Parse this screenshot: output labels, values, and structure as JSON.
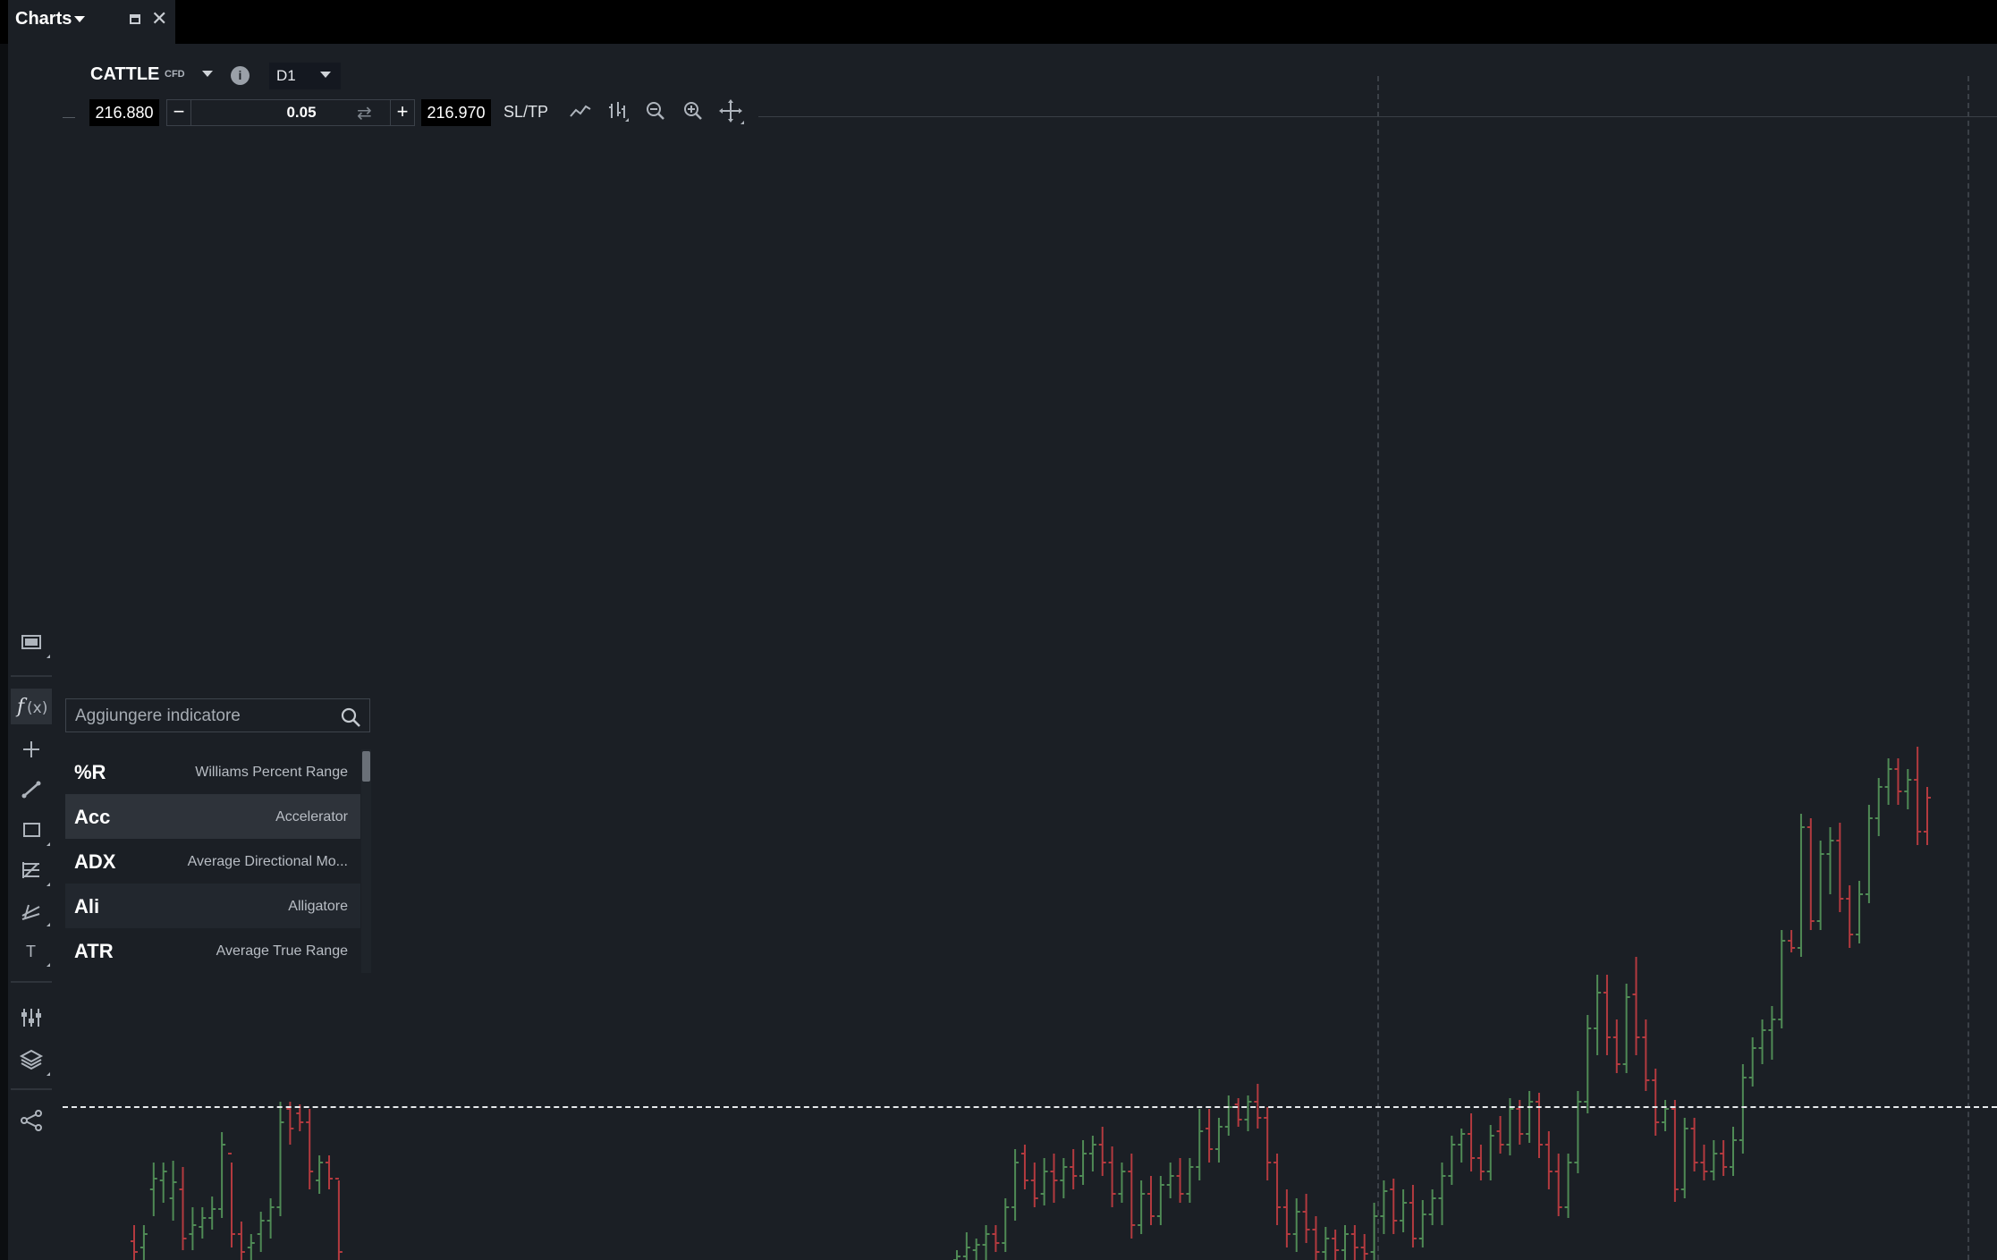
{
  "window": {
    "tab_title": "Charts"
  },
  "instrument": {
    "symbol": "CATTLE",
    "type": "CFD",
    "timeframe": "D1"
  },
  "order": {
    "sell_price": "216.880",
    "lot_size": "0.05",
    "buy_price": "216.970",
    "sltp_label": "SL/TP"
  },
  "toolbar_icons": [
    "line-chart-icon",
    "bar-chart-icon",
    "zoom-out-icon",
    "zoom-in-icon",
    "crosshair-move-icon"
  ],
  "left_tools": [
    "screen-icon",
    "fx-icon",
    "crosshair-icon",
    "line-draw-icon",
    "rectangle-icon",
    "fibonacci-icon",
    "channel-icon",
    "text-icon",
    "indicators-settings-icon",
    "layers-icon",
    "share-icon"
  ],
  "indicator_search": {
    "placeholder": "Aggiungere indicatore",
    "items": [
      {
        "code": "%R",
        "name": "Williams Percent Range"
      },
      {
        "code": "Acc",
        "name": "Accelerator"
      },
      {
        "code": "ADX",
        "name": "Average Directional Mo..."
      },
      {
        "code": "Ali",
        "name": "Alligatore"
      },
      {
        "code": "ATR",
        "name": "Average True Range"
      }
    ]
  },
  "colors": {
    "background": "#1b1f25",
    "bull": "#4f8a55",
    "bear": "#b33a3f"
  },
  "chart_data": {
    "type": "ohlc",
    "series_colors": {
      "up": "#4f8a55",
      "down": "#b33a3f"
    },
    "bars": [
      {
        "c": "r",
        "o": 1388,
        "h": 1370,
        "l": 1409,
        "cl": 1400
      },
      {
        "c": "g",
        "o": 1395,
        "h": 1370,
        "l": 1409,
        "cl": 1380
      },
      {
        "c": "g",
        "o": 1330,
        "h": 1300,
        "l": 1360,
        "cl": 1318
      },
      {
        "c": "g",
        "o": 1320,
        "h": 1300,
        "l": 1345,
        "cl": 1310
      },
      {
        "c": "g",
        "o": 1340,
        "h": 1298,
        "l": 1365,
        "cl": 1322
      },
      {
        "c": "r",
        "o": 1330,
        "h": 1305,
        "l": 1398,
        "cl": 1385
      },
      {
        "c": "g",
        "o": 1380,
        "h": 1350,
        "l": 1398,
        "cl": 1370
      },
      {
        "c": "g",
        "o": 1372,
        "h": 1350,
        "l": 1385,
        "cl": 1362
      },
      {
        "c": "g",
        "o": 1362,
        "h": 1338,
        "l": 1375,
        "cl": 1352
      },
      {
        "c": "g",
        "o": 1352,
        "h": 1266,
        "l": 1362,
        "cl": 1280
      },
      {
        "c": "r",
        "o": 1290,
        "h": 1300,
        "l": 1395,
        "cl": 1380
      },
      {
        "c": "r",
        "o": 1380,
        "h": 1366,
        "l": 1409,
        "cl": 1400
      },
      {
        "c": "g",
        "o": 1395,
        "h": 1380,
        "l": 1409,
        "cl": 1390
      },
      {
        "c": "g",
        "o": 1380,
        "h": 1355,
        "l": 1400,
        "cl": 1365
      },
      {
        "c": "g",
        "o": 1365,
        "h": 1340,
        "l": 1385,
        "cl": 1350
      },
      {
        "c": "g",
        "o": 1350,
        "h": 1232,
        "l": 1360,
        "cl": 1255
      },
      {
        "c": "r",
        "o": 1240,
        "h": 1232,
        "l": 1280,
        "cl": 1262
      },
      {
        "c": "r",
        "o": 1245,
        "h": 1235,
        "l": 1265,
        "cl": 1255
      },
      {
        "c": "r",
        "o": 1255,
        "h": 1240,
        "l": 1330,
        "cl": 1310
      },
      {
        "c": "g",
        "o": 1320,
        "h": 1292,
        "l": 1335,
        "cl": 1300
      },
      {
        "c": "r",
        "o": 1300,
        "h": 1292,
        "l": 1330,
        "cl": 1318
      },
      {
        "c": "r",
        "o": 1318,
        "h": 1320,
        "l": 1409,
        "cl": 1400
      }
    ],
    "bars2": [
      {
        "c": "g",
        "o": 1409,
        "h": 1398,
        "l": 1409,
        "cl": 1405
      },
      {
        "c": "g",
        "o": 1405,
        "h": 1378,
        "l": 1409,
        "cl": 1395
      },
      {
        "c": "g",
        "o": 1398,
        "h": 1385,
        "l": 1409,
        "cl": 1392
      },
      {
        "c": "g",
        "o": 1392,
        "h": 1370,
        "l": 1409,
        "cl": 1380
      },
      {
        "c": "r",
        "o": 1380,
        "h": 1370,
        "l": 1400,
        "cl": 1390
      },
      {
        "c": "g",
        "o": 1390,
        "h": 1340,
        "l": 1400,
        "cl": 1350
      },
      {
        "c": "g",
        "o": 1350,
        "h": 1285,
        "l": 1365,
        "cl": 1300
      },
      {
        "c": "r",
        "o": 1290,
        "h": 1280,
        "l": 1330,
        "cl": 1320
      },
      {
        "c": "r",
        "o": 1320,
        "h": 1300,
        "l": 1350,
        "cl": 1340
      },
      {
        "c": "g",
        "o": 1335,
        "h": 1295,
        "l": 1348,
        "cl": 1310
      },
      {
        "c": "r",
        "o": 1310,
        "h": 1290,
        "l": 1345,
        "cl": 1320
      },
      {
        "c": "g",
        "o": 1320,
        "h": 1295,
        "l": 1340,
        "cl": 1305
      },
      {
        "c": "r",
        "o": 1305,
        "h": 1285,
        "l": 1330,
        "cl": 1315
      },
      {
        "c": "g",
        "o": 1315,
        "h": 1275,
        "l": 1325,
        "cl": 1290
      },
      {
        "c": "g",
        "o": 1290,
        "h": 1270,
        "l": 1310,
        "cl": 1280
      },
      {
        "c": "r",
        "o": 1280,
        "h": 1260,
        "l": 1315,
        "cl": 1300
      },
      {
        "c": "r",
        "o": 1300,
        "h": 1282,
        "l": 1350,
        "cl": 1335
      },
      {
        "c": "g",
        "o": 1335,
        "h": 1300,
        "l": 1345,
        "cl": 1310
      },
      {
        "c": "r",
        "o": 1310,
        "h": 1290,
        "l": 1385,
        "cl": 1370
      },
      {
        "c": "g",
        "o": 1370,
        "h": 1320,
        "l": 1380,
        "cl": 1335
      },
      {
        "c": "r",
        "o": 1335,
        "h": 1315,
        "l": 1370,
        "cl": 1360
      },
      {
        "c": "g",
        "o": 1360,
        "h": 1315,
        "l": 1370,
        "cl": 1325
      },
      {
        "c": "g",
        "o": 1325,
        "h": 1300,
        "l": 1340,
        "cl": 1315
      },
      {
        "c": "r",
        "o": 1315,
        "h": 1295,
        "l": 1345,
        "cl": 1335
      },
      {
        "c": "g",
        "o": 1335,
        "h": 1295,
        "l": 1345,
        "cl": 1305
      },
      {
        "c": "g",
        "o": 1305,
        "h": 1240,
        "l": 1320,
        "cl": 1265
      },
      {
        "c": "r",
        "o": 1262,
        "h": 1240,
        "l": 1300,
        "cl": 1285
      },
      {
        "c": "g",
        "o": 1285,
        "h": 1250,
        "l": 1300,
        "cl": 1260
      },
      {
        "c": "g",
        "o": 1260,
        "h": 1225,
        "l": 1270,
        "cl": 1238
      },
      {
        "c": "r",
        "o": 1235,
        "h": 1228,
        "l": 1260,
        "cl": 1252
      },
      {
        "c": "g",
        "o": 1252,
        "h": 1225,
        "l": 1265,
        "cl": 1232
      },
      {
        "c": "r",
        "o": 1232,
        "h": 1212,
        "l": 1262,
        "cl": 1250
      },
      {
        "c": "r",
        "o": 1250,
        "h": 1238,
        "l": 1320,
        "cl": 1300
      },
      {
        "c": "r",
        "o": 1300,
        "h": 1290,
        "l": 1370,
        "cl": 1350
      },
      {
        "c": "r",
        "o": 1350,
        "h": 1330,
        "l": 1395,
        "cl": 1380
      },
      {
        "c": "g",
        "o": 1380,
        "h": 1340,
        "l": 1400,
        "cl": 1355
      },
      {
        "c": "r",
        "o": 1355,
        "h": 1335,
        "l": 1390,
        "cl": 1375
      },
      {
        "c": "r",
        "o": 1375,
        "h": 1360,
        "l": 1409,
        "cl": 1400
      },
      {
        "c": "g",
        "o": 1400,
        "h": 1372,
        "l": 1409,
        "cl": 1385
      },
      {
        "c": "r",
        "o": 1385,
        "h": 1375,
        "l": 1409,
        "cl": 1398
      },
      {
        "c": "g",
        "o": 1398,
        "h": 1370,
        "l": 1409,
        "cl": 1380
      },
      {
        "c": "r",
        "o": 1380,
        "h": 1370,
        "l": 1409,
        "cl": 1395
      },
      {
        "c": "r",
        "o": 1395,
        "h": 1380,
        "l": 1409,
        "cl": 1402
      },
      {
        "c": "g",
        "o": 1400,
        "h": 1345,
        "l": 1409,
        "cl": 1360
      },
      {
        "c": "g",
        "o": 1360,
        "h": 1320,
        "l": 1380,
        "cl": 1332
      },
      {
        "c": "r",
        "o": 1330,
        "h": 1318,
        "l": 1380,
        "cl": 1365
      },
      {
        "c": "g",
        "o": 1365,
        "h": 1330,
        "l": 1378,
        "cl": 1345
      },
      {
        "c": "r",
        "o": 1345,
        "h": 1325,
        "l": 1395,
        "cl": 1385
      },
      {
        "c": "g",
        "o": 1385,
        "h": 1342,
        "l": 1395,
        "cl": 1358
      },
      {
        "c": "g",
        "o": 1358,
        "h": 1330,
        "l": 1370,
        "cl": 1340
      },
      {
        "c": "g",
        "o": 1340,
        "h": 1300,
        "l": 1370,
        "cl": 1315
      },
      {
        "c": "g",
        "o": 1315,
        "h": 1270,
        "l": 1325,
        "cl": 1280
      },
      {
        "c": "g",
        "o": 1280,
        "h": 1262,
        "l": 1300,
        "cl": 1268
      },
      {
        "c": "r",
        "o": 1268,
        "h": 1245,
        "l": 1310,
        "cl": 1295
      },
      {
        "c": "r",
        "o": 1295,
        "h": 1280,
        "l": 1320,
        "cl": 1310
      },
      {
        "c": "g",
        "o": 1310,
        "h": 1258,
        "l": 1320,
        "cl": 1270
      },
      {
        "c": "r",
        "o": 1265,
        "h": 1248,
        "l": 1290,
        "cl": 1280
      },
      {
        "c": "g",
        "o": 1280,
        "h": 1228,
        "l": 1292,
        "cl": 1240
      },
      {
        "c": "r",
        "o": 1240,
        "h": 1230,
        "l": 1280,
        "cl": 1268
      },
      {
        "c": "g",
        "o": 1268,
        "h": 1220,
        "l": 1278,
        "cl": 1232
      },
      {
        "c": "r",
        "o": 1232,
        "h": 1222,
        "l": 1295,
        "cl": 1280
      },
      {
        "c": "r",
        "o": 1280,
        "h": 1265,
        "l": 1330,
        "cl": 1310
      },
      {
        "c": "r",
        "o": 1310,
        "h": 1290,
        "l": 1360,
        "cl": 1350
      },
      {
        "c": "g",
        "o": 1350,
        "h": 1290,
        "l": 1362,
        "cl": 1300
      },
      {
        "c": "g",
        "o": 1300,
        "h": 1220,
        "l": 1312,
        "cl": 1232
      },
      {
        "c": "g",
        "o": 1232,
        "h": 1135,
        "l": 1245,
        "cl": 1150
      },
      {
        "c": "g",
        "o": 1150,
        "h": 1090,
        "l": 1180,
        "cl": 1110
      },
      {
        "c": "r",
        "o": 1110,
        "h": 1090,
        "l": 1180,
        "cl": 1160
      },
      {
        "c": "r",
        "o": 1160,
        "h": 1140,
        "l": 1200,
        "cl": 1190
      },
      {
        "c": "g",
        "o": 1190,
        "h": 1100,
        "l": 1200,
        "cl": 1115
      },
      {
        "c": "r",
        "o": 1112,
        "h": 1070,
        "l": 1180,
        "cl": 1160
      },
      {
        "c": "r",
        "o": 1160,
        "h": 1140,
        "l": 1220,
        "cl": 1208
      },
      {
        "c": "r",
        "o": 1208,
        "h": 1195,
        "l": 1270,
        "cl": 1255
      },
      {
        "c": "g",
        "o": 1255,
        "h": 1230,
        "l": 1265,
        "cl": 1240
      },
      {
        "c": "r",
        "o": 1240,
        "h": 1230,
        "l": 1344,
        "cl": 1330
      },
      {
        "c": "g",
        "o": 1330,
        "h": 1250,
        "l": 1340,
        "cl": 1262
      },
      {
        "c": "r",
        "o": 1262,
        "h": 1250,
        "l": 1310,
        "cl": 1300
      },
      {
        "c": "r",
        "o": 1300,
        "h": 1280,
        "l": 1320,
        "cl": 1310
      },
      {
        "c": "g",
        "o": 1310,
        "h": 1275,
        "l": 1320,
        "cl": 1290
      },
      {
        "c": "r",
        "o": 1290,
        "h": 1275,
        "l": 1315,
        "cl": 1305
      },
      {
        "c": "g",
        "o": 1305,
        "h": 1260,
        "l": 1315,
        "cl": 1275
      },
      {
        "c": "g",
        "o": 1275,
        "h": 1190,
        "l": 1290,
        "cl": 1205
      },
      {
        "c": "g",
        "o": 1205,
        "h": 1160,
        "l": 1215,
        "cl": 1172
      },
      {
        "c": "g",
        "o": 1172,
        "h": 1140,
        "l": 1190,
        "cl": 1152
      },
      {
        "c": "g",
        "o": 1152,
        "h": 1125,
        "l": 1185,
        "cl": 1140
      },
      {
        "c": "g",
        "o": 1140,
        "h": 1040,
        "l": 1150,
        "cl": 1052
      },
      {
        "c": "r",
        "o": 1052,
        "h": 1040,
        "l": 1065,
        "cl": 1060
      },
      {
        "c": "g",
        "o": 1060,
        "h": 910,
        "l": 1070,
        "cl": 925
      },
      {
        "c": "r",
        "o": 925,
        "h": 915,
        "l": 1040,
        "cl": 1030
      },
      {
        "c": "g",
        "o": 1030,
        "h": 940,
        "l": 1040,
        "cl": 955
      },
      {
        "c": "g",
        "o": 955,
        "h": 925,
        "l": 1000,
        "cl": 940
      },
      {
        "c": "r",
        "o": 940,
        "h": 920,
        "l": 1020,
        "cl": 1005
      },
      {
        "c": "r",
        "o": 1005,
        "h": 990,
        "l": 1060,
        "cl": 1045
      },
      {
        "c": "g",
        "o": 1045,
        "h": 985,
        "l": 1055,
        "cl": 1000
      },
      {
        "c": "g",
        "o": 1000,
        "h": 900,
        "l": 1010,
        "cl": 915
      },
      {
        "c": "g",
        "o": 915,
        "h": 870,
        "l": 935,
        "cl": 880
      },
      {
        "c": "g",
        "o": 880,
        "h": 848,
        "l": 900,
        "cl": 860
      },
      {
        "c": "r",
        "o": 860,
        "h": 848,
        "l": 900,
        "cl": 885
      },
      {
        "c": "g",
        "o": 885,
        "h": 860,
        "l": 905,
        "cl": 872
      },
      {
        "c": "r",
        "o": 872,
        "h": 835,
        "l": 945,
        "cl": 930
      },
      {
        "c": "r",
        "o": 930,
        "h": 880,
        "l": 945,
        "cl": 892
      }
    ]
  }
}
